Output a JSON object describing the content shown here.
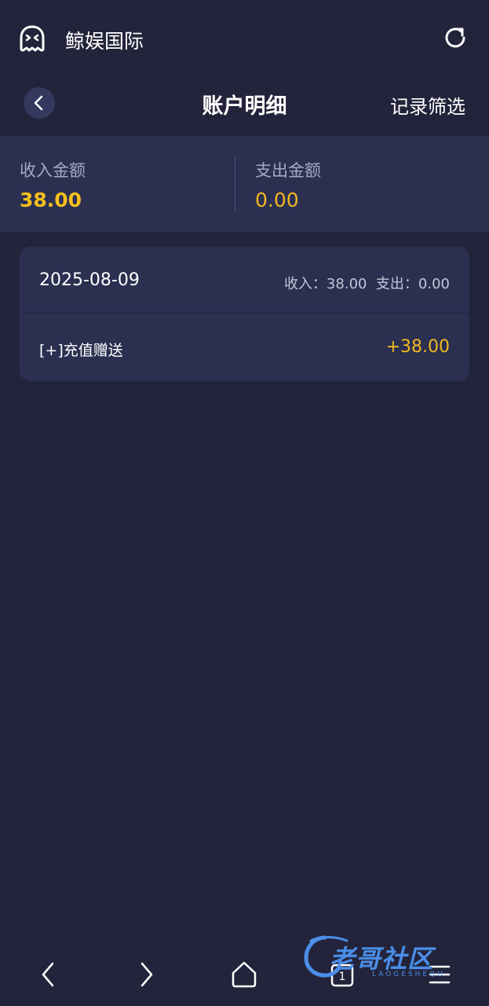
{
  "browser": {
    "site_title": "鲸娱国际",
    "icons": [
      "ghost-icon",
      "refresh-icon"
    ]
  },
  "header": {
    "title": "账户明细",
    "filter_label": "记录筛选",
    "back_icon": "chevron-left-icon"
  },
  "summary": {
    "income_label": "收入金额",
    "income_value": "38.00",
    "expense_label": "支出金额",
    "expense_value": "0.00"
  },
  "records": [
    {
      "date": "2025-08-09",
      "income_text": "收入：38.00",
      "expense_text": "支出：0.00",
      "items": [
        {
          "label": "[+]充值赠送",
          "amount": "+38.00"
        }
      ]
    }
  ],
  "bottom_nav": {
    "items": [
      "back-icon",
      "forward-icon",
      "home-icon",
      "tabs-icon",
      "menu-icon"
    ],
    "tabs_count": "1"
  },
  "watermark": {
    "text": "老哥社区",
    "sub": "LAOGESHEQU"
  },
  "colors": {
    "background": "#23243b",
    "card": "#2b3051",
    "accent": "#f2b720",
    "muted_text": "#a5a9c2"
  }
}
